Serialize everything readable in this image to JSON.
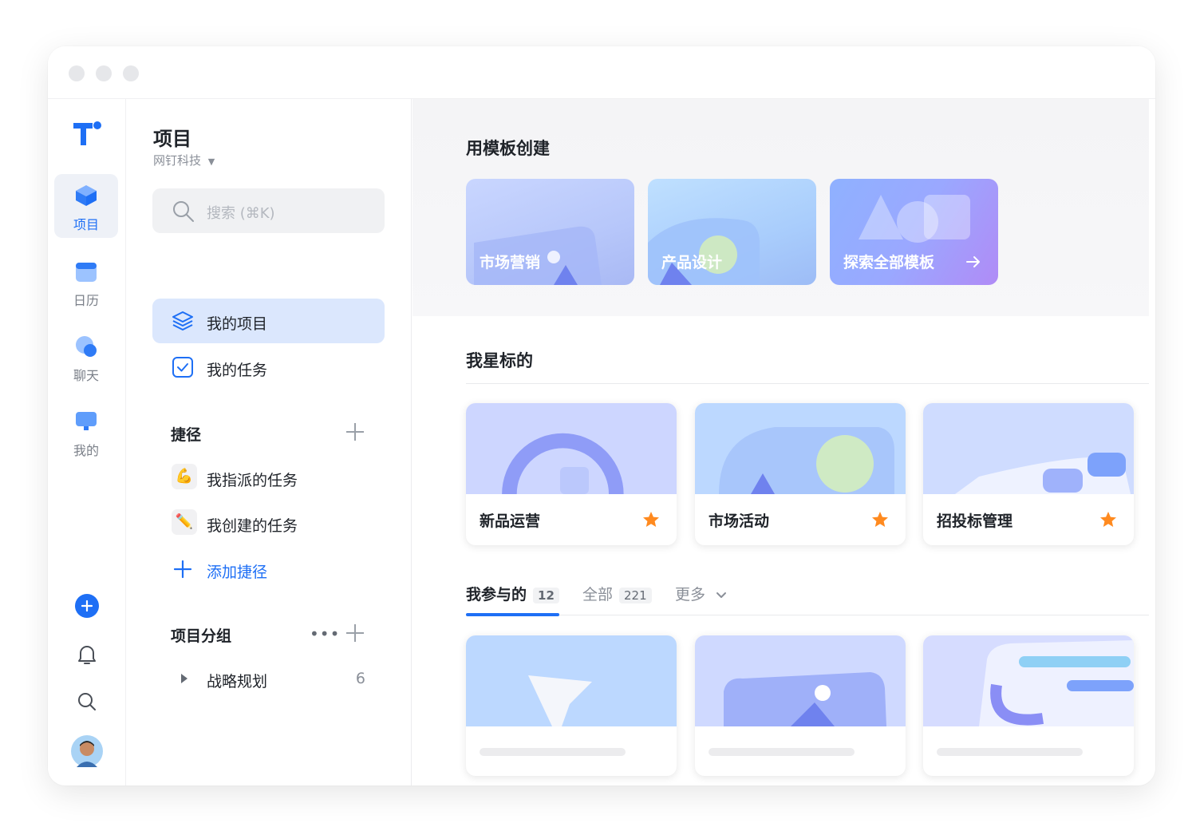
{
  "rail": {
    "items": [
      {
        "label": "项目",
        "icon": "project-cube-icon",
        "active": true
      },
      {
        "label": "日历",
        "icon": "calendar-icon",
        "active": false
      },
      {
        "label": "聊天",
        "icon": "chat-bubble-icon",
        "active": false
      },
      {
        "label": "我的",
        "icon": "my-monitor-icon",
        "active": false
      }
    ],
    "bottom_icons": [
      "add-circle-icon",
      "bell-icon",
      "search-icon",
      "avatar"
    ]
  },
  "panel": {
    "title": "项目",
    "org": "网钉科技",
    "search_placeholder": "搜索 (⌘K)",
    "nav": [
      {
        "label": "我的项目",
        "icon": "layers-icon",
        "active": true
      },
      {
        "label": "我的任务",
        "icon": "checkbox-icon",
        "active": false
      }
    ],
    "shortcuts_title": "捷径",
    "shortcuts": [
      {
        "label": "我指派的任务",
        "emoji": "💪"
      },
      {
        "label": "我创建的任务",
        "emoji": "✏️"
      }
    ],
    "add_shortcut": "添加捷径",
    "groups_title": "项目分组",
    "groups": [
      {
        "label": "战略规划",
        "count": "6"
      }
    ]
  },
  "main": {
    "templates_title": "用模板创建",
    "templates": [
      {
        "label": "市场营销"
      },
      {
        "label": "产品设计"
      },
      {
        "label": "探索全部模板"
      }
    ],
    "starred_title": "我星标的",
    "starred": [
      {
        "label": "新品运营"
      },
      {
        "label": "市场活动"
      },
      {
        "label": "招投标管理"
      }
    ],
    "tabs": [
      {
        "label": "我参与的",
        "count": "12",
        "active": true
      },
      {
        "label": "全部",
        "count": "221",
        "active": false
      },
      {
        "label": "更多",
        "count": "",
        "active": false
      }
    ]
  },
  "colors": {
    "accent": "#1e6ff5",
    "star": "#ff8a1f",
    "nav_active_bg": "#dbe7fd"
  }
}
